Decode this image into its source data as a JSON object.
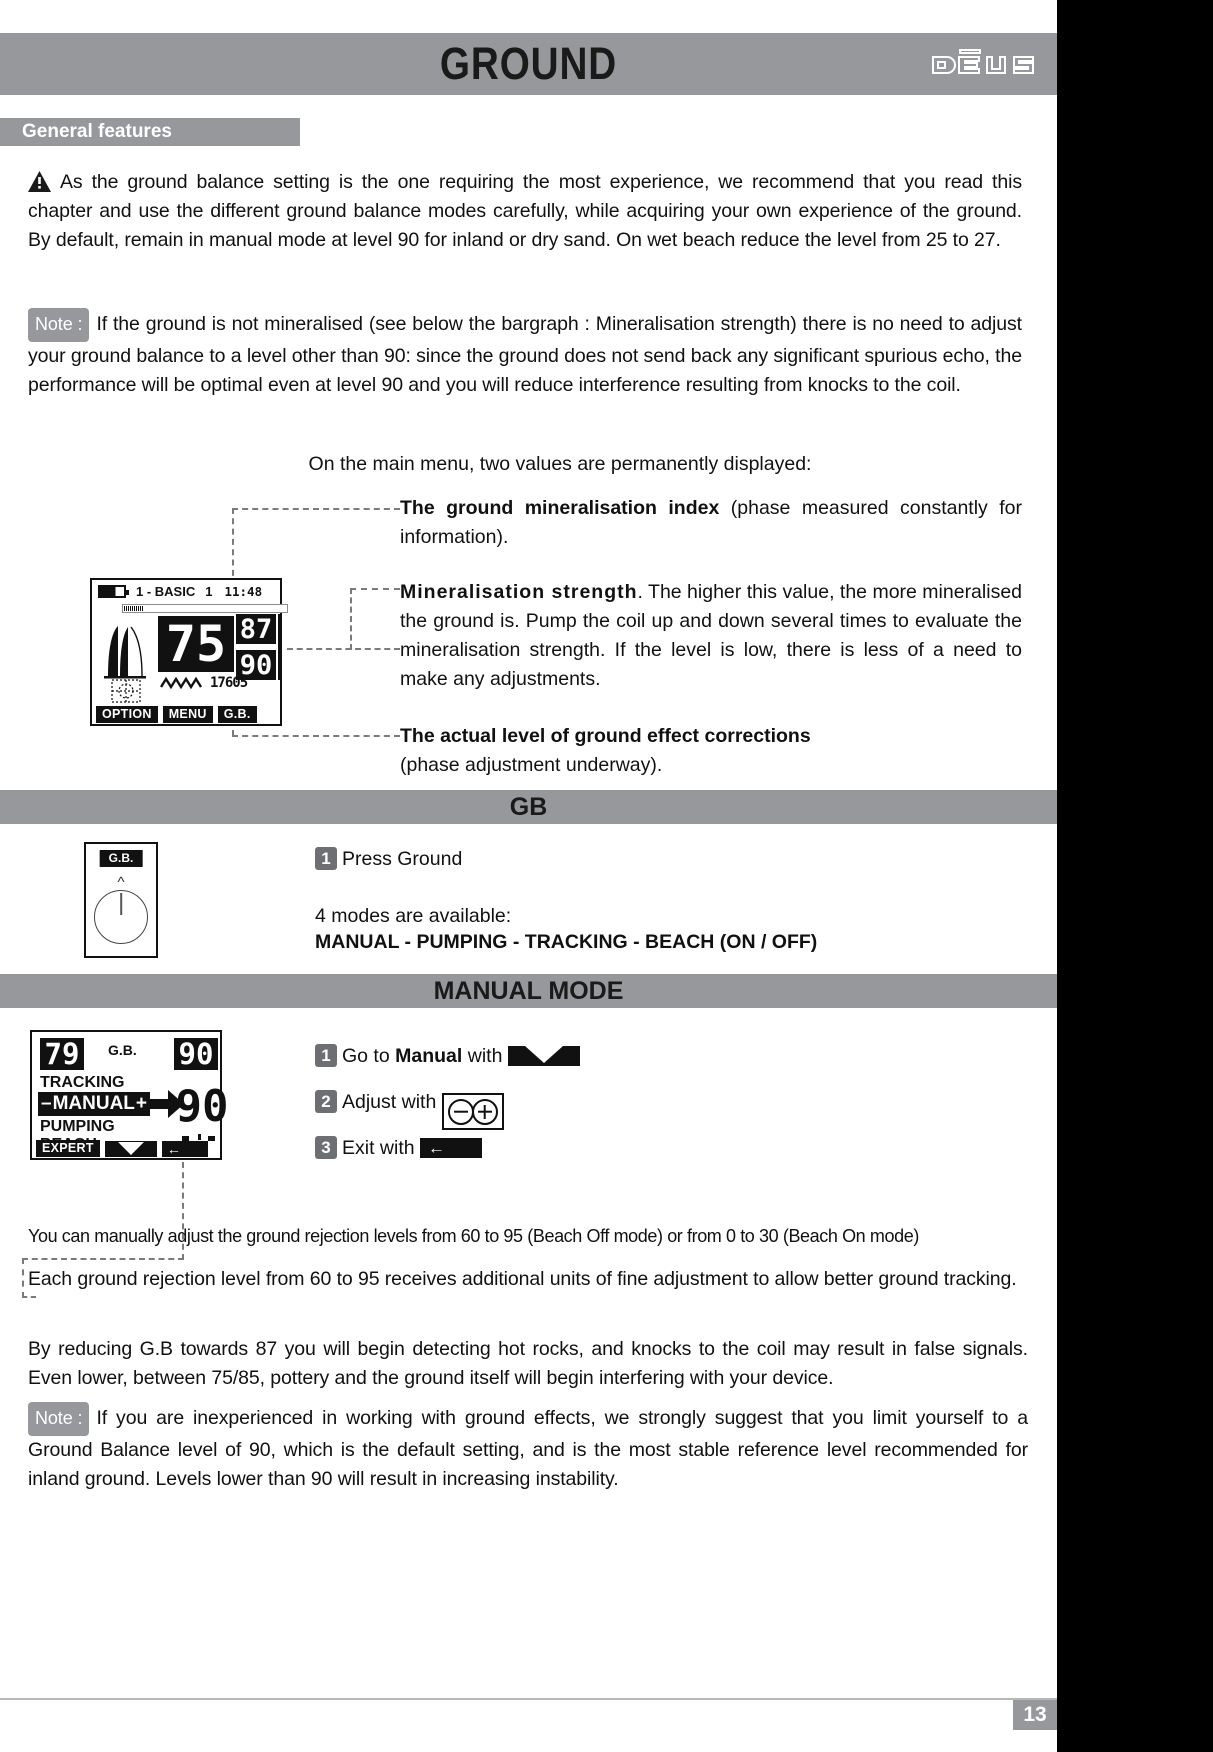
{
  "header": {
    "title": "GROUND",
    "logo_text": "DEUS"
  },
  "sections": {
    "general_features": "General features",
    "gb": "GB",
    "manual_mode": "MANUAL MODE"
  },
  "intro": {
    "warning_text": "As the ground balance setting is the one requiring the most experience, we recommend that you read this chapter and use the different ground balance modes carefully, while acquiring your own experience of the ground. By default, remain in manual mode at level 90 for inland or dry sand. On wet beach reduce the level from 25 to 27.",
    "note_label": "Note :",
    "note_text": "If the ground is not mineralised (see below the bargraph : Mineralisation strength) there is no need to adjust your ground balance to a level other than 90: since the ground does not send back any significant spurious echo, the performance will be optimal even at level 90 and you will reduce interference resulting from knocks to the coil.",
    "main_menu_line": "On the main menu, two values are permanently displayed:"
  },
  "callouts": [
    {
      "bold": "The ground mineralisation index",
      "rest": " (phase measured constantly for information)."
    },
    {
      "bold": "Mineralisation strength",
      "rest": ". The higher this value, the more mineralised the ground is.  Pump the coil up and down several times to evaluate the mineralisation strength. If the level is low, there is less of a need to make any adjustments."
    },
    {
      "bold": "The actual level of ground effect corrections",
      "rest": "(phase adjustment underway)."
    }
  ],
  "lcd_main": {
    "status_mode": "1 - BASIC",
    "status_prog": "1",
    "status_time": "11:48",
    "value_left": "75",
    "value_top_right": "87",
    "value_bottom_right": "90",
    "counter": "17605",
    "buttons": [
      "OPTION",
      "MENU",
      "G.B."
    ]
  },
  "gb_panel": {
    "button_label": "G.B.",
    "step1_num": "1",
    "step1_text": "Press Ground",
    "modes_intro": "4 modes are available:",
    "modes_list": "MANUAL - PUMPING - TRACKING - BEACH (ON / OFF)"
  },
  "lcd_manual": {
    "value_left": "79",
    "title": "G.B.",
    "value_right": "90",
    "menu_items": [
      "TRACKING",
      "MANUAL",
      "PUMPING",
      "BEACH"
    ],
    "selected_item": "MANUAL",
    "minus": "–",
    "plus": "+",
    "big_value": "90",
    "expert_label": "EXPERT"
  },
  "manual_steps": [
    {
      "num": "1",
      "pre": "Go to ",
      "bold": "Manual",
      "post": " with ",
      "icon": "updown-key-icon"
    },
    {
      "num": "2",
      "pre": "Adjust with ",
      "bold": "",
      "post": "",
      "icon": "minus-plus-key-icon"
    },
    {
      "num": "3",
      "pre": "Exit with ",
      "bold": "",
      "post": "",
      "icon": "back-key-icon"
    }
  ],
  "body_paragraphs": [
    "You can manually adjust the ground rejection levels from 60 to 95 (Beach Off mode) or from 0 to 30 (Beach On mode)",
    "Each ground rejection level from 60 to 95 receives additional units of fine adjustment to allow better ground tracking.",
    "By reducing G.B towards 87 you will begin detecting hot rocks, and knocks to the coil may result in false signals. Even lower, between 75/85, pottery and the ground itself will begin interfering with your device."
  ],
  "final_note": {
    "label": "Note :",
    "text": "If you are inexperienced in working with ground effects, we strongly suggest that you limit yourself to a Ground Balance level of 90, which is the default setting, and is the most stable reference level recommended for inland ground. Levels lower than 90 will result in increasing instability."
  },
  "footer": {
    "page_number": "13"
  },
  "colors": {
    "band_gray": "#96989b",
    "chip_gray": "#6d6f72",
    "ink": "#111111"
  }
}
